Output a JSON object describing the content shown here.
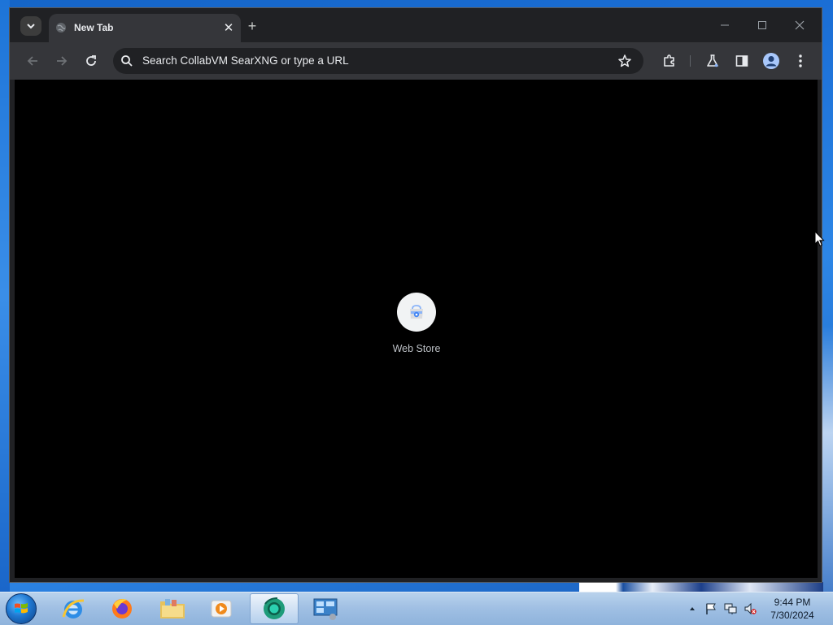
{
  "browser": {
    "tab": {
      "title": "New Tab",
      "close_glyph": "✕"
    },
    "new_tab_glyph": "+",
    "omnibox": {
      "placeholder": "Search CollabVM SearXNG or type a URL"
    },
    "shortcuts": [
      {
        "label": "Web Store",
        "icon": "web-store-icon"
      }
    ],
    "colors": {
      "frame": "#202124",
      "toolbar": "#35363a",
      "content": "#000000"
    }
  },
  "taskbar": {
    "apps": [
      "internet-explorer",
      "firefox",
      "file-explorer",
      "media-player",
      "chrome",
      "control-panel"
    ],
    "clock": {
      "time": "9:44 PM",
      "date": "7/30/2024"
    }
  }
}
